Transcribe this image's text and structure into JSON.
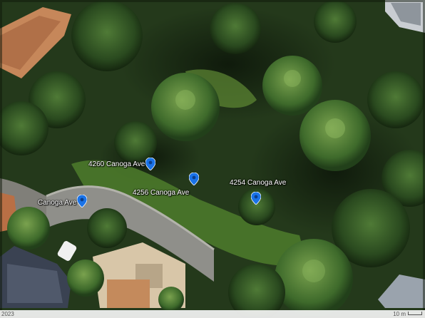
{
  "map": {
    "type": "satellite",
    "places": [
      {
        "label": "4260 Canoga Ave"
      },
      {
        "label": "4256 Canoga Ave"
      },
      {
        "label": "4254 Canoga Ave"
      },
      {
        "label": "Canoga Ave"
      }
    ],
    "pin_icon": "location-pin-icon",
    "pin_color": "#1a73e8"
  },
  "footer": {
    "date_text": "2023",
    "scale_text": "10 m"
  }
}
